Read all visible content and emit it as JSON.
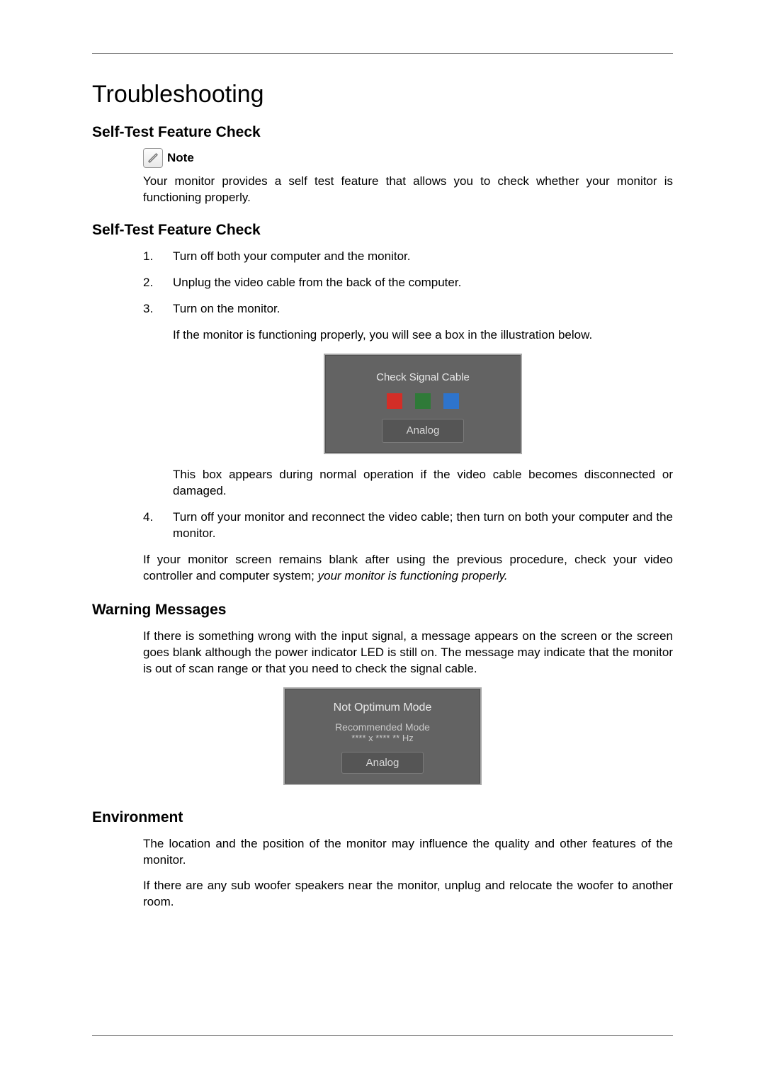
{
  "title": "Troubleshooting",
  "section1": {
    "heading": "Self-Test Feature Check",
    "note_label": "Note",
    "note_text": "Your monitor provides a self test feature that allows you to check whether your monitor is functioning properly."
  },
  "section2": {
    "heading": "Self-Test Feature Check",
    "steps": {
      "s1": "Turn off both your computer and the monitor.",
      "s2": "Unplug the video cable from the back of the computer.",
      "s3a": "Turn on the monitor.",
      "s3b": "If the monitor is functioning properly, you will see a box in the illustration below.",
      "s3c": "This box appears during normal operation if the video cable becomes disconnected or damaged.",
      "s4": "Turn off your monitor and reconnect the video cable; then turn on both your computer and the monitor."
    },
    "after_part1": "If your monitor screen remains blank after using the previous procedure, check your video controller and computer system; ",
    "after_em": "your monitor is functioning properly."
  },
  "box1": {
    "msg": "Check Signal Cable",
    "btn": "Analog"
  },
  "section3": {
    "heading": "Warning Messages",
    "text": "If there is something wrong with the input signal, a message appears on the screen or the screen goes blank although the power indicator LED is still on. The message may indicate that the monitor is out of scan range or that you need to check the signal cable."
  },
  "box2": {
    "line1": "Not  Optimum Mode",
    "line2": "Recommended Mode",
    "line3": "****  x  ****    **  Hz",
    "btn": "Analog"
  },
  "section4": {
    "heading": "Environment",
    "p1": "The location and the position of the monitor may influence the quality and other features of the monitor.",
    "p2": "If there are any sub woofer speakers near the monitor, unplug and relocate the woofer to another room."
  }
}
